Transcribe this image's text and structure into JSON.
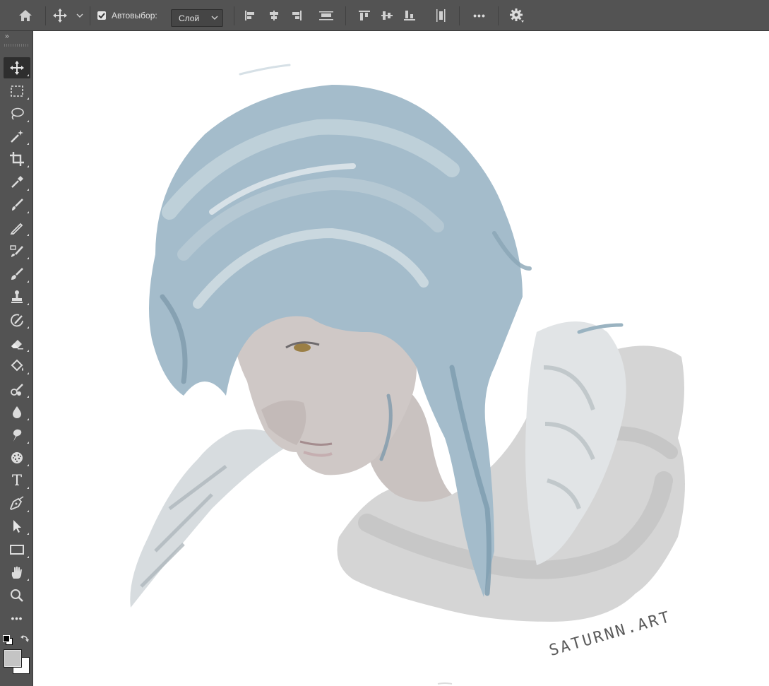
{
  "options_bar": {
    "auto_select_label": "Автовыбор:",
    "auto_select_checked": true,
    "target_value": "Слой",
    "more_label": "•••"
  },
  "toolbar": {
    "collapse_label": "››",
    "tools": [
      {
        "name": "move-tool",
        "icon": "move-icon",
        "selected": true
      },
      {
        "name": "marquee-tool",
        "icon": "rect-marquee-icon"
      },
      {
        "name": "lasso-tool",
        "icon": "lasso-icon"
      },
      {
        "name": "magic-wand-tool",
        "icon": "magic-wand-icon"
      },
      {
        "name": "crop-tool",
        "icon": "crop-icon"
      },
      {
        "name": "eyedropper-tool",
        "icon": "eyedropper-icon"
      },
      {
        "name": "brush-tool",
        "icon": "brush-icon"
      },
      {
        "name": "pencil-tool",
        "icon": "pencil-icon"
      },
      {
        "name": "healing-brush-tool",
        "icon": "healing-brush-icon"
      },
      {
        "name": "mixer-brush-tool",
        "icon": "mixer-brush-icon"
      },
      {
        "name": "clone-stamp-tool",
        "icon": "stamp-icon"
      },
      {
        "name": "history-brush-tool",
        "icon": "history-brush-icon"
      },
      {
        "name": "eraser-tool",
        "icon": "eraser-icon"
      },
      {
        "name": "paint-bucket-tool",
        "icon": "paint-bucket-icon"
      },
      {
        "name": "color-replace-tool",
        "icon": "color-replace-icon"
      },
      {
        "name": "blur-tool",
        "icon": "drop-icon"
      },
      {
        "name": "smudge-tool",
        "icon": "smudge-icon"
      },
      {
        "name": "sponge-tool",
        "icon": "sponge-icon"
      },
      {
        "name": "type-tool",
        "icon": "type-icon",
        "label": "T"
      },
      {
        "name": "pen-tool",
        "icon": "pen-icon"
      },
      {
        "name": "path-selection-tool",
        "icon": "arrow-icon"
      },
      {
        "name": "rectangle-tool",
        "icon": "rectangle-icon"
      },
      {
        "name": "hand-tool",
        "icon": "hand-icon"
      },
      {
        "name": "zoom-tool",
        "icon": "zoom-icon"
      },
      {
        "name": "more-tools",
        "icon": "more-icon",
        "label": "•••"
      }
    ],
    "foreground_color": "#c4c4c4",
    "background_color": "#ffffff"
  },
  "canvas": {
    "signature": "SATURNN.ART",
    "hair_color": "#9fb8c6",
    "skin_color": "#cfc7c4"
  }
}
